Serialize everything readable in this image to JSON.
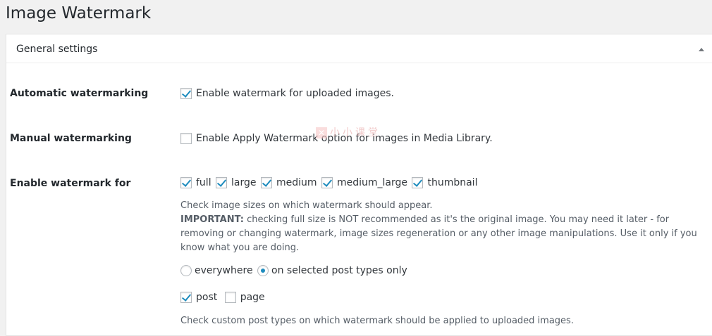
{
  "page": {
    "title": "Image Watermark"
  },
  "section": {
    "title": "General settings"
  },
  "automatic": {
    "label": "Automatic watermarking",
    "checkbox_label": "Enable watermark for uploaded images.",
    "checked": true
  },
  "manual": {
    "label": "Manual watermarking",
    "checkbox_label": "Enable Apply Watermark option for images in Media Library.",
    "checked": false
  },
  "enable_for": {
    "label": "Enable watermark for",
    "sizes": [
      {
        "label": "full",
        "checked": true
      },
      {
        "label": "large",
        "checked": true
      },
      {
        "label": "medium",
        "checked": true
      },
      {
        "label": "medium_large",
        "checked": true
      },
      {
        "label": "thumbnail",
        "checked": true
      }
    ],
    "desc_line1": "Check image sizes on which watermark should appear.",
    "important_label": "IMPORTANT:",
    "important_text": " checking full size is NOT recommended as it's the original image. You may need it later - for removing or changing watermark, image sizes regeneration or any other image manipulations. Use it only if you know what you are doing.",
    "radios": [
      {
        "label": "everywhere",
        "checked": false
      },
      {
        "label": "on selected post types only",
        "checked": true
      }
    ],
    "post_types": [
      {
        "label": "post",
        "checked": true
      },
      {
        "label": "page",
        "checked": false
      }
    ],
    "post_types_desc": "Check custom post types on which watermark should be applied to uploaded images."
  },
  "watermark_overlay": {
    "text": "小小课堂",
    "icon": "x-logo-icon"
  }
}
